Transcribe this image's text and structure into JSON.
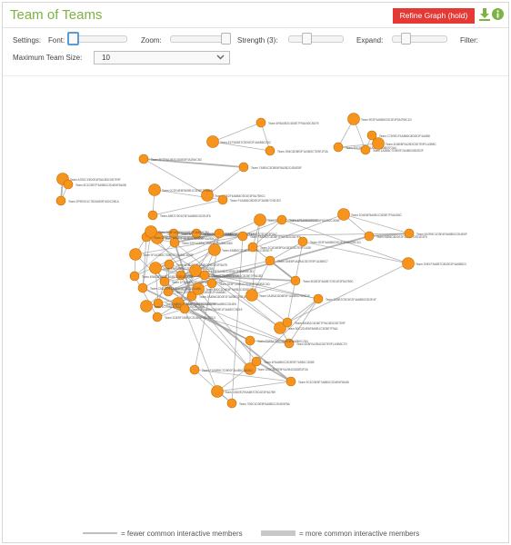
{
  "app": {
    "title": "Team of Teams"
  },
  "toolbar": {
    "refine_label": "Refine Graph (hold)",
    "download_icon": "download-icon",
    "info_icon": "info-icon",
    "accent_color": "#7cb342",
    "refine_color": "#e53935"
  },
  "controls": {
    "settings_label": "Settings:",
    "font_label": "Font:",
    "zoom_label": "Zoom:",
    "strength_label": "Strength (3):",
    "expand_label": "Expand:",
    "filter_label": "Filter:",
    "max_team_size_label": "Maximum Team Size:",
    "max_team_size_value": "10"
  },
  "graph": {
    "node_color": "#f7941d",
    "edge_color": "#999999",
    "nodes": [
      {
        "id": 1,
        "label": "Team A7B2C19D0E4F8A1B3C5D7E9F"
      },
      {
        "id": 2,
        "label": "Team 3F9E0D1C7B2A6E8F4D0C2B1A"
      },
      {
        "id": 3,
        "label": "Team 8C1D5E7F3A9B0C2D4E6F8A0B"
      },
      {
        "id": 4,
        "label": "Team 9E2F4A6B8C0D1E3F5A7B9C1D"
      },
      {
        "id": 5,
        "label": "Team B3C5D7E9F1A2B4C6D8E0F2A4"
      },
      {
        "id": 6,
        "label": "Team 1A3B5C7D9E0F2A4B6C8D0E2F"
      },
      {
        "id": 7,
        "label": "Team 4D6E8F0A2B3C5D7E9F1A3B5C"
      },
      {
        "id": 8,
        "label": "Team C7D9E1F3A5B6C8D0E2F4A6B8"
      },
      {
        "id": 9,
        "label": "Team 6F8A0B2C4D5E7F9A1B3C5D7E"
      },
      {
        "id": 10,
        "label": "Team E1F3A5B7C9D0E2F4A6B8C0D2"
      },
      {
        "id": 11,
        "label": "Team 2B4C6D8E0F1A3B5C7D9E1F3A"
      },
      {
        "id": 12,
        "label": "Team 5E7F9A1B3C4D6E8F0A2B4C6D"
      },
      {
        "id": 13,
        "label": "Team D0E2F4A6B8C9D1E3F5A7B9C1"
      },
      {
        "id": 14,
        "label": "Team 7A9B1C3D5E6F8A0B2C4D6E8F"
      },
      {
        "id": 15,
        "label": "Team F2A4B6C8D0E1F3A5B7C9D1E3"
      },
      {
        "id": 16,
        "label": "Team 0C2D4E6F8A9B1C3D5E7F9A1B"
      },
      {
        "id": 17,
        "label": "Team A5B7C9D1E3F4A6B8C0D2E4F6"
      },
      {
        "id": 18,
        "label": "Team 8F0A2B4C6D7E9F1A3B5C7D9E"
      },
      {
        "id": 19,
        "label": "Team 3D5E7F9A1B2C4D6E8F0A2B4C"
      },
      {
        "id": 20,
        "label": "Team B9C1D3E5F7A8B0C2D4E6F8A0"
      },
      {
        "id": 21,
        "label": "Team 6C8D0E2F4A5B7C9D1E3F5A7B"
      },
      {
        "id": 22,
        "label": "Team E4F6A8B0C2D3E5F7A9B1C3D5"
      },
      {
        "id": 23,
        "label": "Team 1F3A5B7C9D0E2F4A6B8C0D2E"
      },
      {
        "id": 24,
        "label": "Team 9B1C3D5E7F8A0B2C4D6E8F0A"
      },
      {
        "id": 25,
        "label": "Team 4E6F8A0B2C3D5E7F9A1B3C5D"
      },
      {
        "id": 26,
        "label": "Team C2D4E6F8A0B1C3D5E7F9A1B3"
      },
      {
        "id": 27,
        "label": "Team 7D9E1F3A5B6C8D0E2F4A6B8C"
      },
      {
        "id": 28,
        "label": "Team F5A7B9C1D3E4F6A8B0C2D4E6"
      },
      {
        "id": 29,
        "label": "Team 2A4B6C8D0E1F3A5B7C9D1E3F"
      },
      {
        "id": 30,
        "label": "Team A8B0C2D4E6F7A9B1C3D5E7F9"
      },
      {
        "id": 31,
        "label": "Team 5C7D9E1F3A4B6C8D0E2F4A6B"
      },
      {
        "id": 32,
        "label": "Team D3E5F7A9B1C2D4E6F8A0B2C4"
      },
      {
        "id": 33,
        "label": "Team 0F2A4B6C8D9E1F3A5B7C9D1E"
      },
      {
        "id": 34,
        "label": "Team 8B0C2D4E6F7A9B1C3D5E7F9A"
      },
      {
        "id": 35,
        "label": "Team 3E5F7A9B1C2D4E6F8A0B2C4D"
      },
      {
        "id": 36,
        "label": "Team B6C8D0E2F4A5B7C9D1E3F5A7"
      },
      {
        "id": 37,
        "label": "Team 6A8B0C2D4E5F7A9B1C3D5E7F"
      },
      {
        "id": 38,
        "label": "Team E9F1A3B5C7D8E0F2A4B6C8D0"
      },
      {
        "id": 39,
        "label": "Team 1D3E5F7A9B0C2D4E6F8A0B2C"
      },
      {
        "id": 40,
        "label": "Team 9F1A3B5C7D8E0F2A4B6C8D0E"
      },
      {
        "id": 41,
        "label": "Team 4B6C8D0E2F3A5B7C9D1E3F5A"
      },
      {
        "id": 42,
        "label": "Team C5D7E9F1A3B4C6D8E0F2A4B6"
      },
      {
        "id": 43,
        "label": "Team 7E9F1A3B5C6D8E0F2A4B6C8D"
      },
      {
        "id": 44,
        "label": "Team F8A0B2C4D6E7F9A1B3C5D7E9"
      },
      {
        "id": 45,
        "label": "Team 2C4D6E8F0A1B3C5D7E9F1A3B"
      },
      {
        "id": 46,
        "label": "Team A1B3C5D7E9F0A2B4C6D8E0F2"
      },
      {
        "id": 47,
        "label": "Team 5F7A9B1C3D4E6F8A0B2C4D6E"
      },
      {
        "id": 48,
        "label": "Team D6E8F0A2B4C5D7E9F1A3B5C7"
      },
      {
        "id": 49,
        "label": "Team 0A2B4C6D8E9F1A3B5C7D9E1F"
      },
      {
        "id": 50,
        "label": "Team 8D0E2F4A6B7C9D1E3F5A7B9C"
      },
      {
        "id": 51,
        "label": "Team 3A5B7C9D1E2F4A6B8C0D2E4F"
      },
      {
        "id": 52,
        "label": "Team B0C2D4E6F8A9B1C3D5E7F9A1"
      },
      {
        "id": 53,
        "label": "Team 6E8F0A2B4C5D7E9F1A3B5C7D"
      },
      {
        "id": 54,
        "label": "Team E3F5A7B9C1D2E4F6A8B0C2D4"
      },
      {
        "id": 55,
        "label": "Team 1B3C5D7E9F0A2B4C6D8E0F2A"
      },
      {
        "id": 56,
        "label": "Team 9C1D3E5F7A8B0C2D4E6F8A0B"
      },
      {
        "id": 57,
        "label": "Team 4F6A8B0C2D3E5F7A9B1C3D5E"
      },
      {
        "id": 58,
        "label": "Team C8D0E2F4A6B7C9D1E3F5A7B9"
      },
      {
        "id": 59,
        "label": "Team 7B9C1D3E5F6A8B0C2D4E6F8A"
      },
      {
        "id": 60,
        "label": "Team F1A3B5C7D9E0F2A4B6C8D0E2"
      },
      {
        "id": 61,
        "label": "Team 2D4E6F8A0B1C3D5E7F9A1B3C"
      },
      {
        "id": 62,
        "label": "Team A4B6C8D0E2F3A5B7C9D1E3F5"
      },
      {
        "id": 63,
        "label": "Team 5A7B9C1D3E4F6A8B0C2D4E6F"
      },
      {
        "id": 64,
        "label": "Team D9E1F3A5B7C8D0E2F4A6B8C0"
      },
      {
        "id": 65,
        "label": "Team 0E2F4A6B8C9D1E3F5A7B9C1D"
      },
      {
        "id": 66,
        "label": "Team 8A0B2C4D6E7F9A1B3C5D7E9F"
      }
    ],
    "edges": [
      [
        1,
        2
      ],
      [
        1,
        3
      ],
      [
        2,
        3
      ],
      [
        4,
        5
      ],
      [
        4,
        6
      ],
      [
        5,
        6
      ],
      [
        5,
        7
      ],
      [
        7,
        8
      ],
      [
        6,
        8
      ],
      [
        9,
        10
      ],
      [
        9,
        11
      ],
      [
        10,
        11
      ],
      [
        12,
        13
      ],
      [
        13,
        14
      ],
      [
        12,
        14
      ],
      [
        15,
        16
      ],
      [
        16,
        17
      ],
      [
        15,
        17
      ],
      [
        18,
        19
      ],
      [
        19,
        20
      ],
      [
        18,
        20
      ],
      [
        21,
        22
      ],
      [
        22,
        23
      ],
      [
        23,
        24
      ],
      [
        24,
        21
      ],
      [
        21,
        23
      ],
      [
        22,
        24
      ],
      [
        24,
        25
      ],
      [
        25,
        26
      ],
      [
        26,
        27
      ],
      [
        27,
        21
      ],
      [
        21,
        26
      ],
      [
        22,
        27
      ],
      [
        23,
        26
      ],
      [
        25,
        28
      ],
      [
        28,
        29
      ],
      [
        29,
        24
      ],
      [
        30,
        23
      ],
      [
        30,
        22
      ],
      [
        31,
        30
      ],
      [
        31,
        29
      ],
      [
        32,
        28
      ],
      [
        33,
        28
      ],
      [
        33,
        32
      ],
      [
        34,
        33
      ],
      [
        34,
        35
      ],
      [
        35,
        36
      ],
      [
        36,
        37
      ],
      [
        37,
        34
      ],
      [
        36,
        38
      ],
      [
        38,
        39
      ],
      [
        39,
        40
      ],
      [
        40,
        41
      ],
      [
        41,
        38
      ],
      [
        39,
        42
      ],
      [
        42,
        43
      ],
      [
        43,
        44
      ],
      [
        44,
        40
      ],
      [
        45,
        46
      ],
      [
        46,
        47
      ],
      [
        45,
        47
      ],
      [
        48,
        49
      ],
      [
        49,
        50
      ],
      [
        48,
        50
      ],
      [
        51,
        52
      ],
      [
        52,
        53
      ],
      [
        51,
        53
      ],
      [
        53,
        54
      ],
      [
        54,
        55
      ],
      [
        55,
        51
      ],
      [
        56,
        57
      ],
      [
        57,
        58
      ],
      [
        56,
        58
      ],
      [
        58,
        59
      ],
      [
        59,
        60
      ],
      [
        60,
        56
      ],
      [
        61,
        62
      ],
      [
        62,
        63
      ],
      [
        61,
        63
      ],
      [
        64,
        65
      ],
      [
        65,
        66
      ],
      [
        64,
        66
      ],
      [
        25,
        45
      ],
      [
        27,
        34
      ],
      [
        29,
        38
      ],
      [
        32,
        41
      ],
      [
        36,
        44
      ],
      [
        26,
        39
      ],
      [
        28,
        36
      ],
      [
        31,
        37
      ],
      [
        21,
        47
      ],
      [
        23,
        56
      ],
      [
        24,
        61
      ],
      [
        22,
        51
      ],
      [
        26,
        48
      ],
      [
        30,
        53
      ],
      [
        33,
        58
      ],
      [
        35,
        60
      ],
      [
        27,
        62
      ],
      [
        37,
        42
      ],
      [
        40,
        55
      ],
      [
        43,
        57
      ],
      [
        44,
        59
      ],
      [
        39,
        63
      ],
      [
        41,
        46
      ],
      [
        42,
        54
      ],
      [
        38,
        52
      ],
      [
        45,
        50
      ],
      [
        46,
        49
      ],
      [
        47,
        64
      ],
      [
        48,
        65
      ],
      [
        49,
        66
      ],
      [
        50,
        24
      ],
      [
        51,
        25
      ],
      [
        52,
        26
      ],
      [
        53,
        27
      ],
      [
        54,
        28
      ],
      [
        55,
        29
      ]
    ]
  },
  "legend": {
    "thin_label": "= fewer common interactive members",
    "thick_label": "= more common interactive members"
  }
}
